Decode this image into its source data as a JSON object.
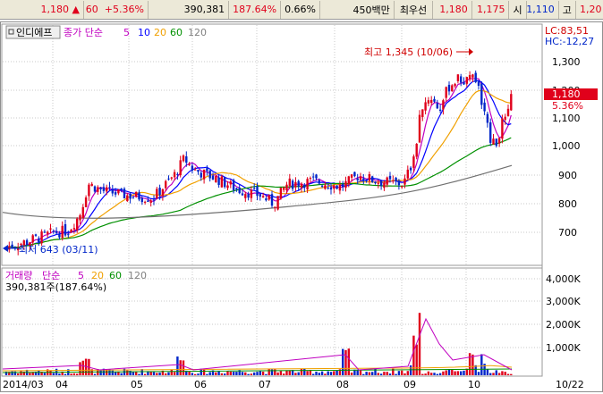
{
  "ticker": {
    "price": "1,180",
    "change_arrow": "▲",
    "change": "60",
    "change_pct": "+5.36%",
    "volume": "390,381",
    "volume_ratio": "187.64%",
    "turnover_ratio": "0.66%",
    "amount": "450백만",
    "bid_label": "최우선",
    "ask": "1,180",
    "bid": "1,175",
    "open_label": "시",
    "open": "1,110",
    "high_label": "고",
    "high": "1,20"
  },
  "price_panel": {
    "index_button": "인디에프",
    "ma_label": "종가 단순",
    "ma_periods": [
      "5",
      "10",
      "20",
      "60",
      "120"
    ],
    "lc": "LC:83,51",
    "hc": "HC:-12,27",
    "high_note": "최고 1,345 (10/06)",
    "low_note": "최저 643 (03/11)",
    "y_ticks": [
      "1,300",
      "1,200",
      "1,100",
      "1,000",
      "900",
      "800",
      "700"
    ],
    "last_price": "1,180",
    "last_pct": "5.36%"
  },
  "volume_panel": {
    "label": "거래량",
    "ma_label": "단순",
    "ma_periods": [
      "5",
      "20",
      "60",
      "120"
    ],
    "current": "390,381주(187.64%)",
    "y_ticks": [
      "4,000K",
      "3,000K",
      "2,000K",
      "1,000K"
    ]
  },
  "x_axis": {
    "labels": [
      "2014/03",
      "04",
      "05",
      "06",
      "07",
      "08",
      "09",
      "10",
      "10/22"
    ]
  },
  "colors": {
    "up": "#e0001b",
    "down": "#0026c9",
    "ma5": "#c000c0",
    "ma10": "#0000ff",
    "ma20": "#f0a000",
    "ma60": "#009000",
    "ma120": "#707070"
  },
  "chart_data": {
    "type": "line",
    "x_labels": [
      "03",
      "04",
      "05",
      "06",
      "07",
      "08",
      "09",
      "10"
    ],
    "series": [
      {
        "name": "종가",
        "values": [
          650,
          720,
          880,
          1010,
          800,
          880,
          1250,
          1180
        ]
      }
    ],
    "annotations": [
      "최고 1,345 (10/06)",
      "최저 643 (03/11)"
    ]
  }
}
